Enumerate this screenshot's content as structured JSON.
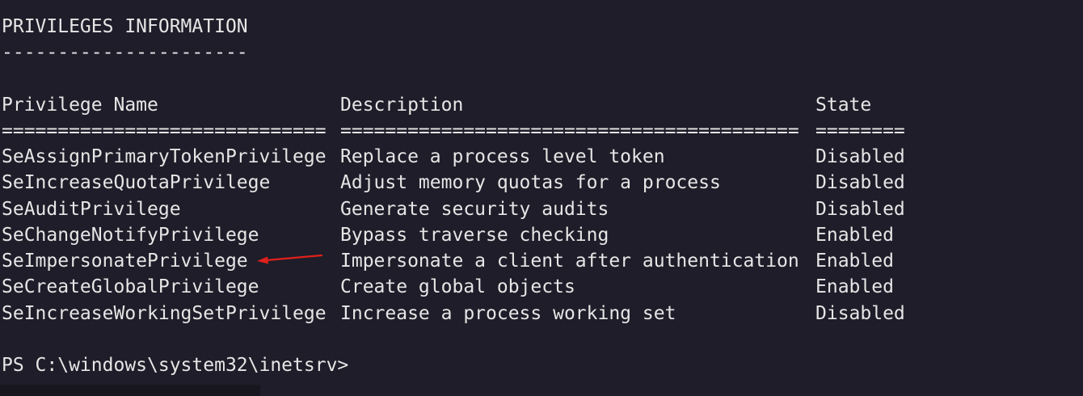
{
  "header": {
    "title": "PRIVILEGES INFORMATION",
    "underline": "----------------------"
  },
  "table": {
    "columns": [
      "Privilege Name",
      "Description",
      "State"
    ],
    "separators": [
      "=============================",
      "=========================================",
      "========"
    ],
    "rows": [
      {
        "name": "SeAssignPrimaryTokenPrivilege",
        "description": "Replace a process level token",
        "state": "Disabled"
      },
      {
        "name": "SeIncreaseQuotaPrivilege",
        "description": "Adjust memory quotas for a process",
        "state": "Disabled"
      },
      {
        "name": "SeAuditPrivilege",
        "description": "Generate security audits",
        "state": "Disabled"
      },
      {
        "name": "SeChangeNotifyPrivilege",
        "description": "Bypass traverse checking",
        "state": "Enabled"
      },
      {
        "name": "SeImpersonatePrivilege",
        "description": "Impersonate a client after authentication",
        "state": "Enabled"
      },
      {
        "name": "SeCreateGlobalPrivilege",
        "description": "Create global objects",
        "state": "Enabled"
      },
      {
        "name": "SeIncreaseWorkingSetPrivilege",
        "description": "Increase a process working set",
        "state": "Disabled"
      }
    ]
  },
  "prompt": "PS C:\\windows\\system32\\inetsrv>",
  "annotation": {
    "icon": "red-arrow-icon",
    "color": "#e0201c"
  }
}
